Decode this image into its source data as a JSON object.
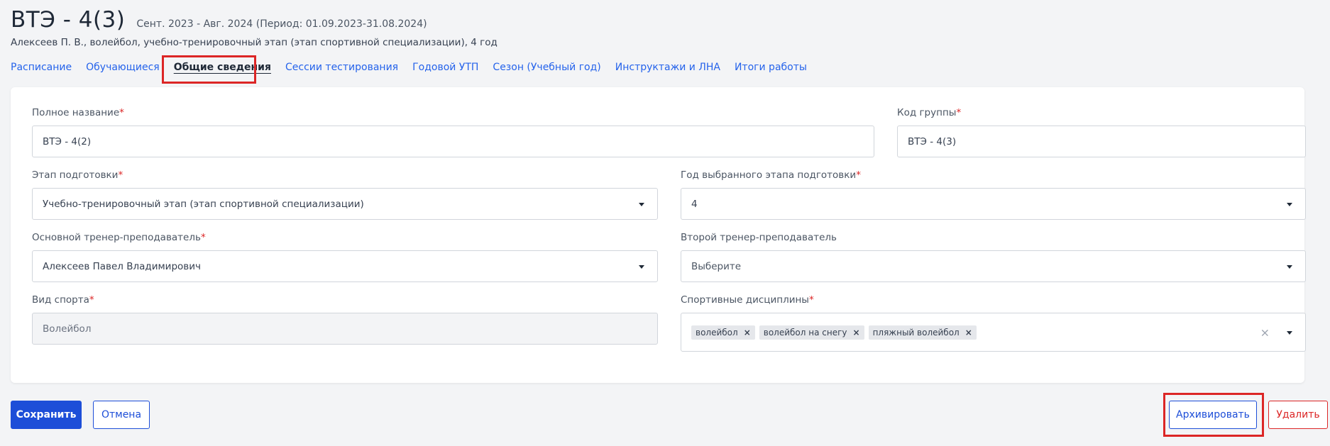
{
  "header": {
    "title": "ВТЭ - 4(3)",
    "period": "Сент. 2023 - Авг. 2024 (Период: 01.09.2023-31.08.2024)",
    "subtitle": "Алексеев П. В., волейбол, учебно-тренировочный этап (этап спортивной специализации), 4 год"
  },
  "tabs": [
    {
      "label": "Расписание",
      "active": false
    },
    {
      "label": "Обучающиеся",
      "active": false
    },
    {
      "label": "Общие сведения",
      "active": true
    },
    {
      "label": "Сессии тестирования",
      "active": false
    },
    {
      "label": "Годовой УТП",
      "active": false
    },
    {
      "label": "Сезон (Учебный год)",
      "active": false
    },
    {
      "label": "Инструктажи и ЛНА",
      "active": false
    },
    {
      "label": "Итоги работы",
      "active": false
    }
  ],
  "form": {
    "full_name": {
      "label": "Полное название",
      "value": "ВТЭ - 4(2)"
    },
    "group_code": {
      "label": "Код группы",
      "value": "ВТЭ - 4(3)"
    },
    "stage": {
      "label": "Этап подготовки",
      "value": "Учебно-тренировочный этап (этап спортивной специализации)"
    },
    "stage_year": {
      "label": "Год выбранного этапа подготовки",
      "value": "4"
    },
    "main_coach": {
      "label": "Основной тренер-преподаватель",
      "value": "Алексеев Павел Владимирович"
    },
    "second_coach": {
      "label": "Второй тренер-преподаватель",
      "placeholder": "Выберите"
    },
    "sport": {
      "label": "Вид спорта",
      "value": "Волейбол"
    },
    "disciplines": {
      "label": "Спортивные дисциплины",
      "chips": [
        "волейбол",
        "волейбол на снегу",
        "пляжный волейбол"
      ]
    },
    "required_mark": "*"
  },
  "actions": {
    "save": "Сохранить",
    "cancel": "Отмена",
    "archive": "Архивировать",
    "delete": "Удалить"
  },
  "colors": {
    "accent": "#1d4ed8",
    "link": "#2563eb",
    "danger": "#dc2626",
    "highlight": "#dc2626"
  },
  "icons": {
    "dropdown": "chevron-down-icon",
    "chip_remove": "close-icon",
    "clear": "clear-icon"
  }
}
